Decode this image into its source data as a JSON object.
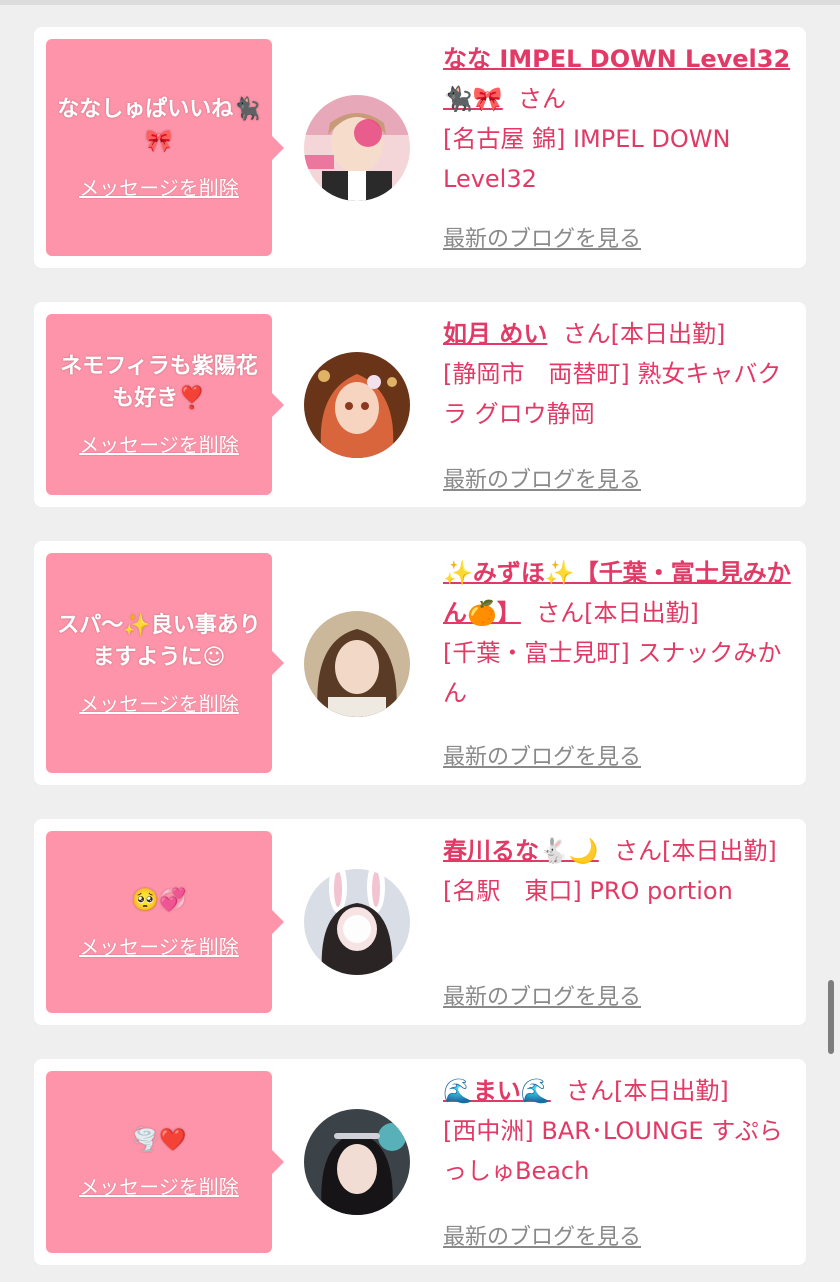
{
  "delete_label": "メッセージを削除",
  "blog_label": "最新のブログを見る",
  "san_label": "さん",
  "cards": [
    {
      "message": "ななしゅぱいいね🐈‍⬛🎀",
      "name": "なな IMPEL DOWN Level32🐈‍⬛🎀",
      "attendance": "",
      "shop": "[名古屋 錦] IMPEL DOWN Level32"
    },
    {
      "message": "ネモフィラも紫陽花も好き❣️",
      "name": "如月 めい",
      "attendance": "[本日出勤]",
      "shop": "[静岡市　両替町] 熟女キャバクラ グロウ静岡"
    },
    {
      "message": "スパ〜✨良い事ありますように☺︎",
      "name": "✨みずほ✨【千葉・富士見みかん🍊】",
      "attendance": "[本日出勤]",
      "shop": "[千葉・富士見町] スナックみかん"
    },
    {
      "message": "🥺💞",
      "name": "春川るな🐇🌙",
      "attendance": "[本日出勤]",
      "shop": "[名駅　東口] PRO portion"
    },
    {
      "message": "🌪️❤️",
      "name": "🌊まい🌊",
      "attendance": "[本日出勤]",
      "shop": "[西中洲] BAR･LOUNGE すぷらっしゅBeach"
    }
  ]
}
